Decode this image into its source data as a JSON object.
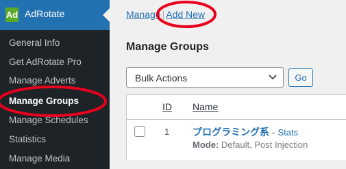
{
  "sidebar": {
    "app_title": "AdRotate",
    "logo_text": "Ad",
    "items": [
      {
        "label": "General Info"
      },
      {
        "label": "Get AdRotate Pro"
      },
      {
        "label": "Manage Adverts"
      },
      {
        "label": "Manage Groups"
      },
      {
        "label": "Manage Schedules"
      },
      {
        "label": "Statistics"
      },
      {
        "label": "Manage Media"
      }
    ],
    "colors": {
      "background": "#1d2327",
      "active": "#2271b1",
      "logo": "#5aaa28"
    }
  },
  "nav": {
    "manage_label": "Manage",
    "separator": "|",
    "add_new_label": "Add New"
  },
  "page": {
    "title": "Manage Groups"
  },
  "bulk": {
    "selected": "Bulk Actions",
    "go_label": "Go"
  },
  "table": {
    "columns": [
      "ID",
      "Name"
    ],
    "rows": [
      {
        "id": "1",
        "name": "プログラミング系",
        "dash": " - ",
        "stats_link": "Stats",
        "mode_label": "Mode:",
        "mode_value": "Default, Post Injection"
      }
    ]
  },
  "annotation": {
    "color": "#e8001c"
  }
}
